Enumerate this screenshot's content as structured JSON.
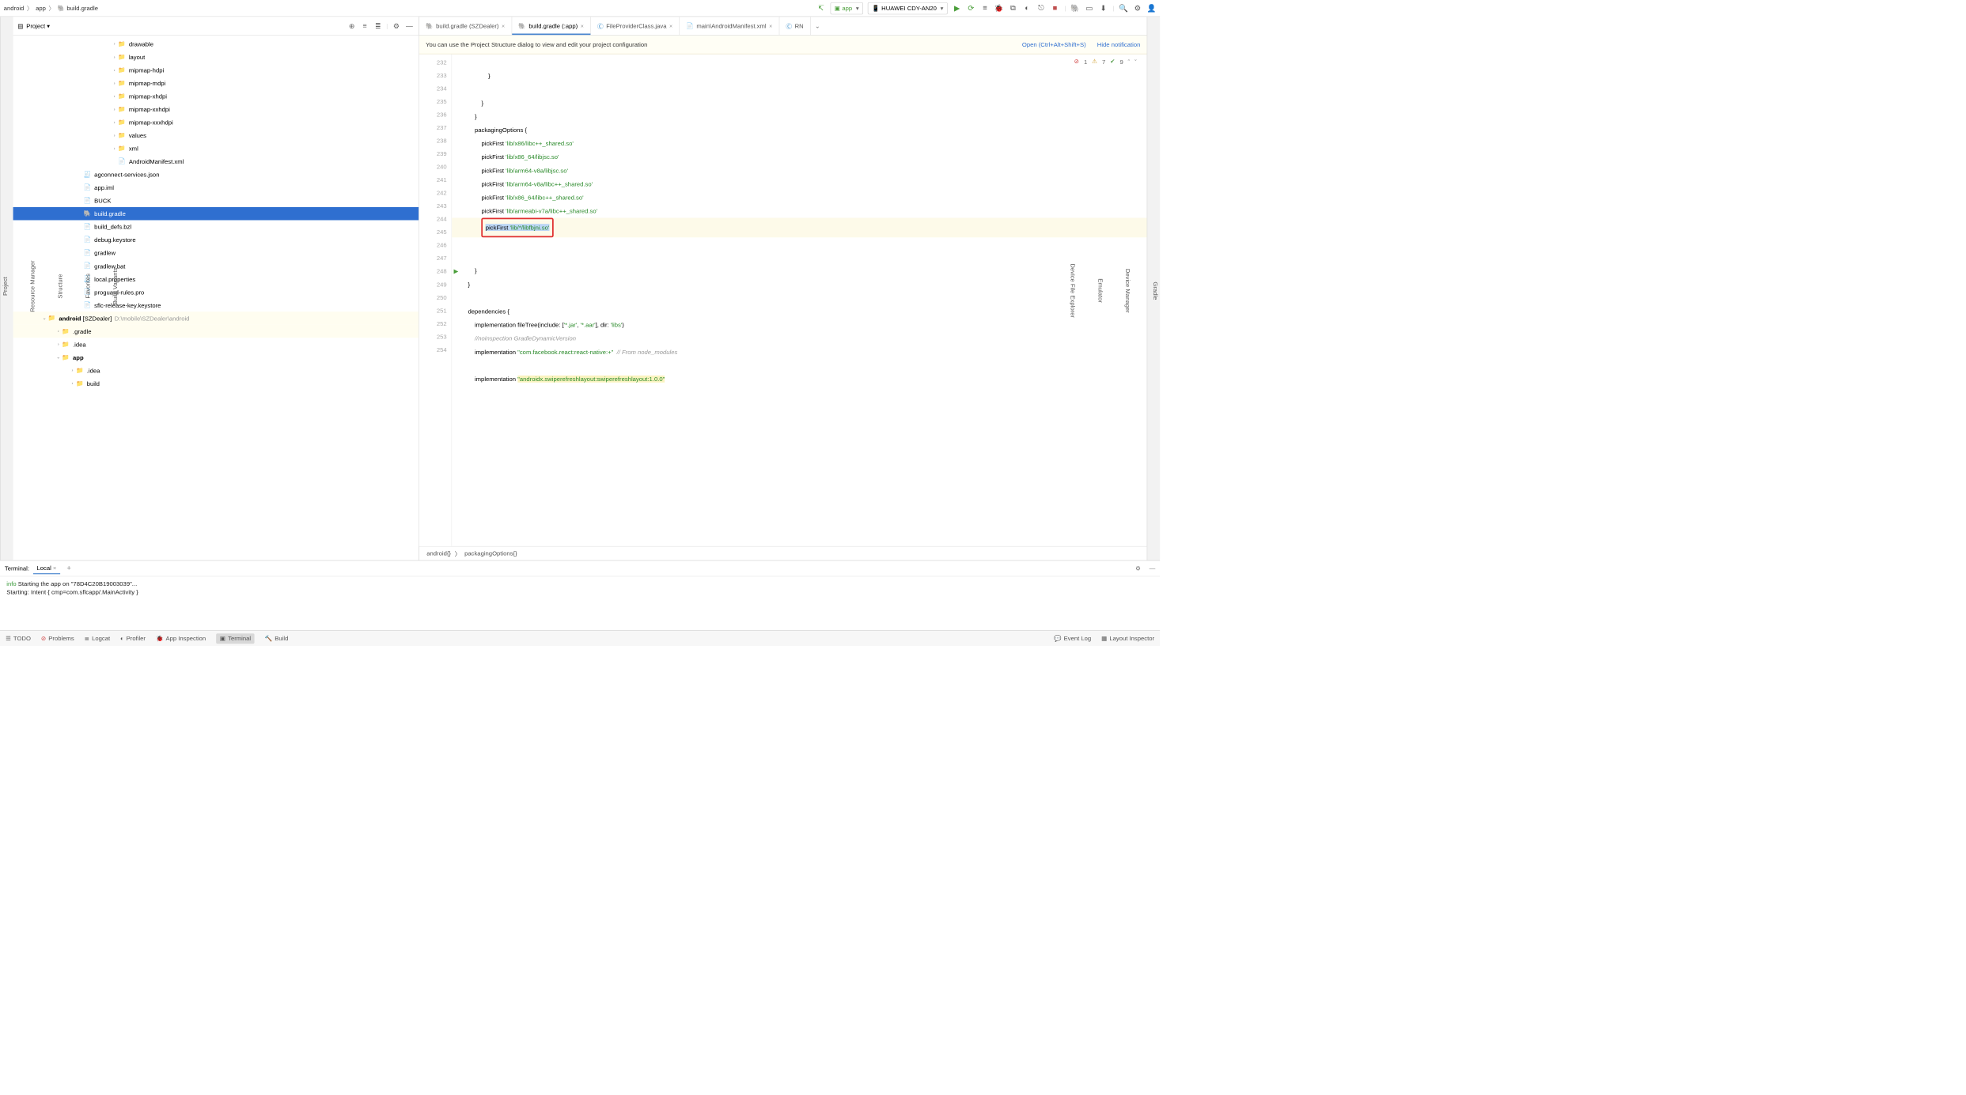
{
  "breadcrumb": {
    "p0": "android",
    "p1": "app",
    "p2": "build.gradle"
  },
  "toolbar": {
    "run_config": "app",
    "device": "HUAWEI CDY-AN20"
  },
  "left_edge": {
    "i0": "Project",
    "i1": "Resource Manager",
    "i2": "Structure",
    "i3": "Favorites",
    "i4": "Build Variants"
  },
  "right_edge": {
    "i0": "Gradle",
    "i1": "Device Manager",
    "i2": "Emulator",
    "i3": "Device File Explorer"
  },
  "project": {
    "title": "Project",
    "tree": {
      "n0": "drawable",
      "n1": "layout",
      "n2": "mipmap-hdpi",
      "n3": "mipmap-mdpi",
      "n4": "mipmap-xhdpi",
      "n5": "mipmap-xxhdpi",
      "n6": "mipmap-xxxhdpi",
      "n7": "values",
      "n8": "xml",
      "n9": "AndroidManifest.xml",
      "n10": "agconnect-services.json",
      "n11": "app.iml",
      "n12": "BUCK",
      "n13": "build.gradle",
      "n14": "build_defs.bzl",
      "n15": "debug.keystore",
      "n16": "gradlew",
      "n17": "gradlew.bat",
      "n18": "local.properties",
      "n19": "proguard-rules.pro",
      "n20": "sflc-release-key.keystore",
      "n21": "android",
      "n21b": "[SZDealer]",
      "n21p": "D:\\mobile\\SZDealer\\android",
      "n22": ".gradle",
      "n23": ".idea",
      "n24": "app",
      "n25": ".idea",
      "n26": "build"
    }
  },
  "tabs": {
    "t0": "build.gradle (SZDealer)",
    "t1": "build.gradle (:app)",
    "t2": "FileProviderClass.java",
    "t3": "main\\AndroidManifest.xml",
    "t4": "RN"
  },
  "notif": {
    "msg": "You can use the Project Structure dialog to view and edit your project configuration",
    "open": "Open (Ctrl+Alt+Shift+S)",
    "hide": "Hide notification"
  },
  "code_status": {
    "errors": "1",
    "warnings": "7",
    "weak": "9"
  },
  "gutter": {
    "start": 232,
    "end": 254
  },
  "code": {
    "l232": "                }",
    "l233": "",
    "l234": "            }",
    "l235": "        }",
    "l236_a": "        packagingOptions ",
    "l236_b": "{",
    "l237_a": "            pickFirst ",
    "l237_b": "'lib/x86/libc++_shared.so'",
    "l238_a": "            pickFirst ",
    "l238_b": "'lib/x86_64/libjsc.so'",
    "l239_a": "            pickFirst ",
    "l239_b": "'lib/arm64-v8a/libjsc.so'",
    "l240_a": "            pickFirst ",
    "l240_b": "'lib/arm64-v8a/libc++_shared.so'",
    "l241_a": "            pickFirst ",
    "l241_b": "'lib/x86_64/libc++_shared.so'",
    "l242_a": "            pickFirst ",
    "l242_b": "'lib/armeabi-v7a/libc++_shared.so'",
    "l243_a": "pickFirst ",
    "l243_b": "'lib/*/libfbjni.so'",
    "l244": "",
    "l245": "        }",
    "l246": "    }",
    "l247": "",
    "l248_a": "    dependencies ",
    "l248_b": "{",
    "l249_a": "        implementation ",
    "l249_b": "fileTree",
    "l249_c": "(include: [",
    "l249_d": "'*.jar'",
    "l249_e": ", ",
    "l249_f": "'*.aar'",
    "l249_g": "], dir: ",
    "l249_h": "'libs'",
    "l249_i": ")",
    "l250": "        //noinspection GradleDynamicVersion",
    "l251_a": "        implementation ",
    "l251_b": "\"com.facebook.react:react-native:+\"",
    "l251_c": "  // From node_modules",
    "l252": "",
    "l253_a": "        implementation ",
    "l253_b": "\"androidx.swiperefreshlayout:swiperefreshlayout:1.0.0\"",
    "l254": ""
  },
  "editor_bc": {
    "b0": "android{}",
    "b1": "packagingOptions{}"
  },
  "terminal": {
    "title": "Terminal:",
    "tab": "Local",
    "line1a": "info",
    "line1b": " Starting the app on \"78D4C20B19003039\"...",
    "line2": "Starting: Intent { cmp=com.sflcapp/.MainActivity }"
  },
  "bottom": {
    "todo": "TODO",
    "problems": "Problems",
    "logcat": "Logcat",
    "profiler": "Profiler",
    "appinsp": "App Inspection",
    "terminal": "Terminal",
    "build": "Build",
    "eventlog": "Event Log",
    "layoutinsp": "Layout Inspector"
  }
}
